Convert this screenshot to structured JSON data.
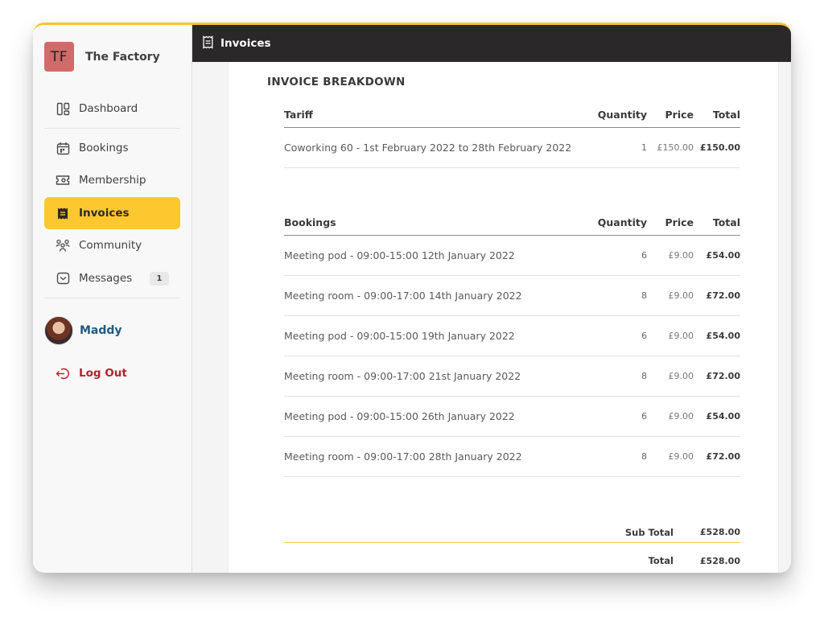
{
  "brand": {
    "initials": "TF",
    "name": "The Factory",
    "logo_color": "#cf6b6b"
  },
  "header": {
    "title": "Invoices",
    "icon": "receipt-icon"
  },
  "sidebar": {
    "items": [
      {
        "label": "Dashboard",
        "icon": "dashboard-icon",
        "active": false
      },
      {
        "label": "Bookings",
        "icon": "calendar-icon",
        "active": false
      },
      {
        "label": "Membership",
        "icon": "ticket-icon",
        "active": false
      },
      {
        "label": "Invoices",
        "icon": "receipt-icon",
        "active": true
      },
      {
        "label": "Community",
        "icon": "people-icon",
        "active": false
      },
      {
        "label": "Messages",
        "icon": "inbox-icon",
        "active": false,
        "badge": "1"
      }
    ],
    "user": {
      "name": "Maddy"
    },
    "logout_label": "Log Out"
  },
  "invoice": {
    "title": "INVOICE BREAKDOWN",
    "tariff": {
      "headers": [
        "Tariff",
        "Quantity",
        "Price",
        "Total"
      ],
      "rows": [
        {
          "desc": "Coworking 60 - 1st February 2022 to 28th February 2022",
          "qty": "1",
          "price": "£150.00",
          "total": "£150.00"
        }
      ]
    },
    "bookings": {
      "headers": [
        "Bookings",
        "Quantity",
        "Price",
        "Total"
      ],
      "rows": [
        {
          "desc": "Meeting pod - 09:00-15:00 12th January 2022",
          "qty": "6",
          "price": "£9.00",
          "total": "£54.00"
        },
        {
          "desc": "Meeting room - 09:00-17:00 14th January 2022",
          "qty": "8",
          "price": "£9.00",
          "total": "£72.00"
        },
        {
          "desc": "Meeting pod - 09:00-15:00 19th January 2022",
          "qty": "6",
          "price": "£9.00",
          "total": "£54.00"
        },
        {
          "desc": "Meeting room - 09:00-17:00 21st January 2022",
          "qty": "8",
          "price": "£9.00",
          "total": "£72.00"
        },
        {
          "desc": "Meeting pod - 09:00-15:00 26th January 2022",
          "qty": "6",
          "price": "£9.00",
          "total": "£54.00"
        },
        {
          "desc": "Meeting room - 09:00-17:00 28th January 2022",
          "qty": "8",
          "price": "£9.00",
          "total": "£72.00"
        }
      ]
    },
    "subtotal_label": "Sub Total",
    "subtotal": "£528.00",
    "total_label": "Total",
    "total": "£528.00"
  },
  "colors": {
    "accent": "#fdc72f",
    "header_bg": "#2a2828",
    "logout": "#b3222a",
    "user_name": "#245a7e"
  }
}
